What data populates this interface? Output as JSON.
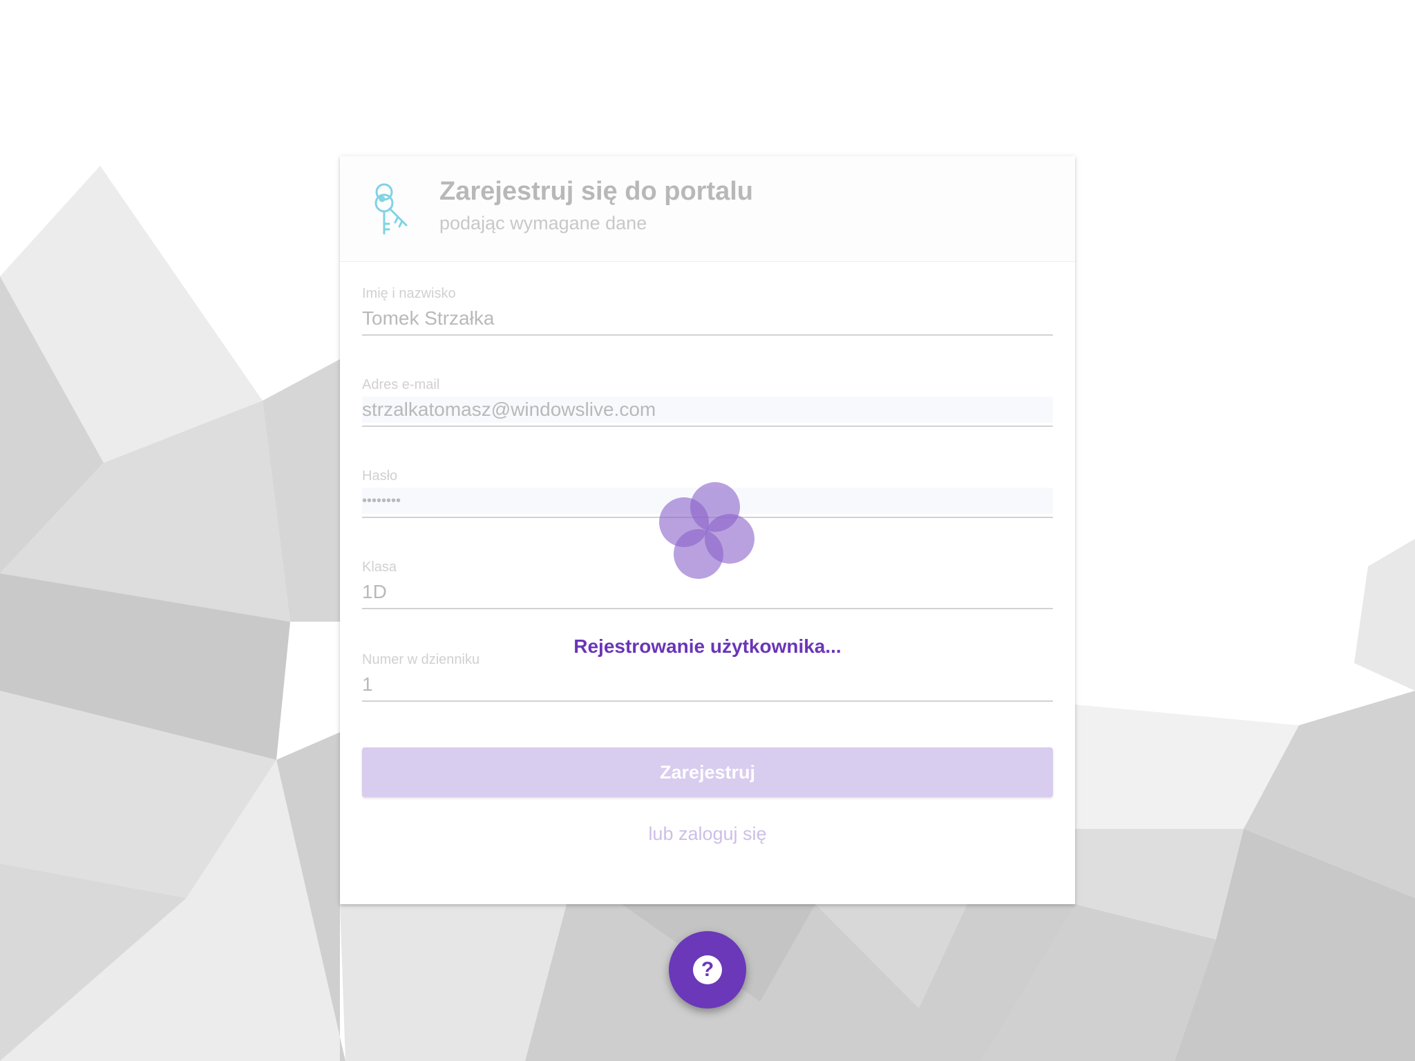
{
  "header": {
    "title": "Zarejestruj się do portalu",
    "subtitle": "podając wymagane dane",
    "icon": "keys-icon"
  },
  "form": {
    "fields": [
      {
        "label": "Imię i nazwisko",
        "value": "Tomek Strzałka"
      },
      {
        "label": "Adres e-mail",
        "value": "strzalkatomasz@windowslive.com"
      },
      {
        "label": "Hasło",
        "value": "••••••••"
      },
      {
        "label": "Klasa",
        "value": "1D"
      },
      {
        "label": "Numer w dzienniku",
        "value": "1"
      }
    ],
    "submit_label": "Zarejestruj",
    "login_link": "lub zaloguj się"
  },
  "overlay": {
    "loading_text": "Rejestrowanie użytkownika...",
    "spinner_icon": "loading-spinner-icon"
  },
  "help": {
    "icon": "help-icon",
    "glyph": "?"
  },
  "colors": {
    "accent": "#6a38b9",
    "button_disabled": "#d8ccef",
    "icon_teal": "#7fd3e3"
  }
}
